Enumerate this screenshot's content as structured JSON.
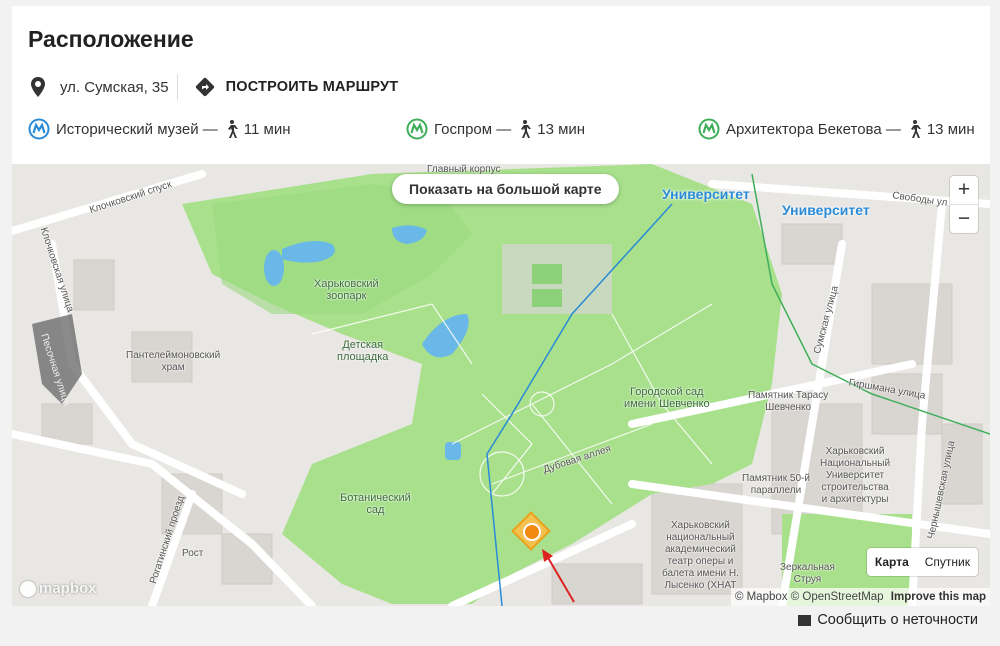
{
  "location": {
    "title": "Расположение",
    "address": "ул. Сумская, 35",
    "route_label": "ПОСТРОИТЬ МАРШРУТ",
    "metro": [
      {
        "station": "Исторический музей —",
        "time": "11 мин"
      },
      {
        "station": "Госпром —",
        "time": "13 мин"
      },
      {
        "station": "Архитектора Бекетова —",
        "time": "13 мин"
      }
    ]
  },
  "map": {
    "big_map_label": "Показать на большой карте",
    "zoom_in": "+",
    "zoom_out": "−",
    "layer_map": "Карта",
    "layer_satellite": "Спутник",
    "logo": "mapbox",
    "attribution": "© Mapbox © OpenStreetMap",
    "improve": "Improve this map",
    "labels": {
      "main_building": "Главный корпус",
      "klochkovsky_descent": "Клочковский спуск",
      "klochkovskaya": "Клочковская улица",
      "pesochnaya": "Песочная улица",
      "zoo": "Харьковский\nзоопарк",
      "playground": "Детская\nплощадка",
      "church": "Пантелеймоновский\nхрам",
      "garden": "Городской сад\nимени Шевченко",
      "monument": "Памятник Тарасу\nШевченко",
      "parallel": "Памятник 50-й\nпараллели",
      "botanical": "Ботанический\nсад",
      "dubovaya": "Дубовая аллея",
      "rogatinsky": "Рогатинский проезд",
      "rost": "Рост",
      "theatre": "Харьковский\nнациональный\nакадемический\nтеатр оперы и\nбалета имени Н.\nЛысенко (ХНАТ",
      "university_building": "Харьковский\nНациональный\nУниверситет\nстроительства\nи архитектуры",
      "sumskaya": "Сумская улица",
      "girshmana": "Гиршмана улица",
      "chernyshevskaya": "Чернышевская улица",
      "svobody": "Свободы ул",
      "mirror": "Зеркальная\nСтруя",
      "metro_university_1": "Университет",
      "metro_university_2": "Университет"
    }
  },
  "report_label": "Сообщить о неточности",
  "colors": {
    "park": "#a8e08c",
    "water": "#6ab8e8",
    "metro_blue": "#2a8bd6",
    "metro_green": "#3fae5a",
    "marker": "#f28a12"
  }
}
